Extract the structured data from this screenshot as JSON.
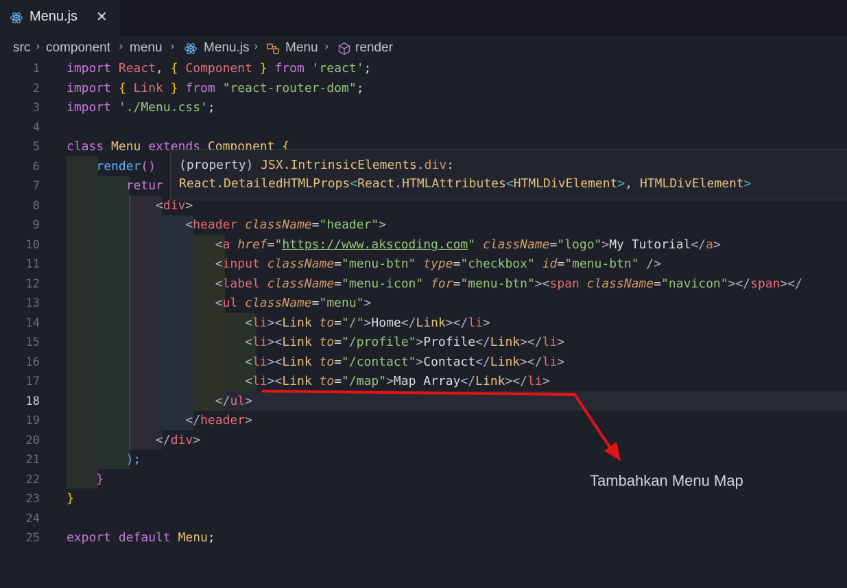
{
  "tab": {
    "label": "Menu.js",
    "close_glyph": "✕",
    "icon": "react-icon"
  },
  "breadcrumb": {
    "items": [
      "src",
      "component",
      "menu",
      "Menu.js",
      "Menu",
      "render"
    ],
    "separator": "›"
  },
  "hover": {
    "line1": "(property) JSX.IntrinsicElements.div:",
    "line2": "React.DetailedHTMLProps<React.HTMLAttributes<HTMLDivElement>, HTMLDivElement>"
  },
  "annotation": {
    "text": "Tambahkan Menu Map",
    "color": "#e31414"
  },
  "active_line": 18,
  "lines": [
    {
      "n": "1",
      "tokens": [
        [
          "import ",
          "k"
        ],
        [
          "React",
          "t"
        ],
        [
          ", ",
          ""
        ],
        [
          "{ ",
          "br"
        ],
        [
          "Component",
          "t"
        ],
        [
          " }",
          "br"
        ],
        [
          " from ",
          "k"
        ],
        [
          "'react'",
          "s"
        ],
        [
          ";",
          ""
        ]
      ]
    },
    {
      "n": "2",
      "tokens": [
        [
          "import ",
          "k"
        ],
        [
          "{ ",
          "br"
        ],
        [
          "Link",
          "t"
        ],
        [
          " }",
          "br"
        ],
        [
          " from ",
          "k"
        ],
        [
          "\"react-router-dom\"",
          "s"
        ],
        [
          ";",
          ""
        ]
      ]
    },
    {
      "n": "3",
      "tokens": [
        [
          "import ",
          "k"
        ],
        [
          "'./Menu.css'",
          "s"
        ],
        [
          ";",
          ""
        ]
      ]
    },
    {
      "n": "4",
      "tokens": []
    },
    {
      "n": "5",
      "tokens": [
        [
          "class ",
          "k"
        ],
        [
          "Menu ",
          "c"
        ],
        [
          "extends ",
          "k"
        ],
        [
          "Component ",
          "c"
        ],
        [
          "{",
          "br"
        ]
      ]
    },
    {
      "n": "6",
      "tokens": [
        [
          "    ",
          ""
        ],
        [
          "render",
          "f"
        ],
        [
          "()",
          "brp"
        ]
      ]
    },
    {
      "n": "7",
      "tokens": [
        [
          "        ",
          ""
        ],
        [
          "retur",
          "k"
        ]
      ]
    },
    {
      "n": "8",
      "tokens": [
        [
          "            ",
          ""
        ],
        [
          "<",
          "p"
        ],
        [
          "div",
          "t"
        ],
        [
          ">",
          "p"
        ]
      ]
    },
    {
      "n": "9",
      "tokens": [
        [
          "                ",
          ""
        ],
        [
          "<",
          "p"
        ],
        [
          "header ",
          "t"
        ],
        [
          "className",
          "a"
        ],
        [
          "=",
          ""
        ],
        [
          "\"header\"",
          "s"
        ],
        [
          ">",
          "p"
        ]
      ]
    },
    {
      "n": "10",
      "tokens": [
        [
          "                    ",
          ""
        ],
        [
          "<",
          "p"
        ],
        [
          "a ",
          "t"
        ],
        [
          "href",
          "a"
        ],
        [
          "=",
          ""
        ],
        [
          "\"",
          "s"
        ],
        [
          "https://www.akscoding.com",
          "u"
        ],
        [
          "\" ",
          "s"
        ],
        [
          "className",
          "a"
        ],
        [
          "=",
          ""
        ],
        [
          "\"logo\"",
          "s"
        ],
        [
          ">",
          "p"
        ],
        [
          "My Tutorial",
          ""
        ],
        [
          "</",
          "p"
        ],
        [
          "a",
          "t"
        ],
        [
          ">",
          "p"
        ]
      ]
    },
    {
      "n": "11",
      "tokens": [
        [
          "                    ",
          ""
        ],
        [
          "<",
          "p"
        ],
        [
          "input ",
          "t"
        ],
        [
          "className",
          "a"
        ],
        [
          "=",
          ""
        ],
        [
          "\"menu-btn\" ",
          "s"
        ],
        [
          "type",
          "a"
        ],
        [
          "=",
          ""
        ],
        [
          "\"checkbox\" ",
          "s"
        ],
        [
          "id",
          "a"
        ],
        [
          "=",
          ""
        ],
        [
          "\"menu-btn\" ",
          "s"
        ],
        [
          "/>",
          "p"
        ]
      ]
    },
    {
      "n": "12",
      "tokens": [
        [
          "                    ",
          ""
        ],
        [
          "<",
          "p"
        ],
        [
          "label ",
          "t"
        ],
        [
          "className",
          "a"
        ],
        [
          "=",
          ""
        ],
        [
          "\"menu-icon\" ",
          "s"
        ],
        [
          "for",
          "a"
        ],
        [
          "=",
          ""
        ],
        [
          "\"menu-btn\"",
          "s"
        ],
        [
          ">",
          "p"
        ],
        [
          "<",
          "p"
        ],
        [
          "span ",
          "t"
        ],
        [
          "className",
          "a"
        ],
        [
          "=",
          ""
        ],
        [
          "\"navicon\"",
          "s"
        ],
        [
          "></",
          "p"
        ],
        [
          "span",
          "t"
        ],
        [
          "></",
          "p"
        ]
      ]
    },
    {
      "n": "13",
      "tokens": [
        [
          "                    ",
          ""
        ],
        [
          "<",
          "p"
        ],
        [
          "ul ",
          "t"
        ],
        [
          "className",
          "a"
        ],
        [
          "=",
          ""
        ],
        [
          "\"menu\"",
          "s"
        ],
        [
          ">",
          "p"
        ]
      ]
    },
    {
      "n": "14",
      "tokens": [
        [
          "                        ",
          ""
        ],
        [
          "<",
          "p"
        ],
        [
          "li",
          "t"
        ],
        [
          "><",
          "p"
        ],
        [
          "Link ",
          "c"
        ],
        [
          "to",
          "a"
        ],
        [
          "=",
          ""
        ],
        [
          "\"/\"",
          "s"
        ],
        [
          ">",
          "p"
        ],
        [
          "Home",
          ""
        ],
        [
          "</",
          "p"
        ],
        [
          "Link",
          "c"
        ],
        [
          "></",
          "p"
        ],
        [
          "li",
          "t"
        ],
        [
          ">",
          "p"
        ]
      ]
    },
    {
      "n": "15",
      "tokens": [
        [
          "                        ",
          ""
        ],
        [
          "<",
          "p"
        ],
        [
          "li",
          "t"
        ],
        [
          "><",
          "p"
        ],
        [
          "Link ",
          "c"
        ],
        [
          "to",
          "a"
        ],
        [
          "=",
          ""
        ],
        [
          "\"/profile\"",
          "s"
        ],
        [
          ">",
          "p"
        ],
        [
          "Profile",
          ""
        ],
        [
          "</",
          "p"
        ],
        [
          "Link",
          "c"
        ],
        [
          "></",
          "p"
        ],
        [
          "li",
          "t"
        ],
        [
          ">",
          "p"
        ]
      ]
    },
    {
      "n": "16",
      "tokens": [
        [
          "                        ",
          ""
        ],
        [
          "<",
          "p"
        ],
        [
          "li",
          "t"
        ],
        [
          "><",
          "p"
        ],
        [
          "Link ",
          "c"
        ],
        [
          "to",
          "a"
        ],
        [
          "=",
          ""
        ],
        [
          "\"/contact\"",
          "s"
        ],
        [
          ">",
          "p"
        ],
        [
          "Contact",
          ""
        ],
        [
          "</",
          "p"
        ],
        [
          "Link",
          "c"
        ],
        [
          "></",
          "p"
        ],
        [
          "li",
          "t"
        ],
        [
          ">",
          "p"
        ]
      ]
    },
    {
      "n": "17",
      "tokens": [
        [
          "                        ",
          ""
        ],
        [
          "<",
          "p"
        ],
        [
          "li",
          "t"
        ],
        [
          "><",
          "p"
        ],
        [
          "Link ",
          "c"
        ],
        [
          "to",
          "a"
        ],
        [
          "=",
          ""
        ],
        [
          "\"/map\"",
          "s"
        ],
        [
          ">",
          "p"
        ],
        [
          "Map Array",
          ""
        ],
        [
          "</",
          "p"
        ],
        [
          "Link",
          "c"
        ],
        [
          "></",
          "p"
        ],
        [
          "li",
          "t"
        ],
        [
          ">",
          "p"
        ]
      ]
    },
    {
      "n": "18",
      "tokens": [
        [
          "                    ",
          ""
        ],
        [
          "</",
          "p"
        ],
        [
          "ul",
          "t"
        ],
        [
          ">",
          "p"
        ]
      ]
    },
    {
      "n": "19",
      "tokens": [
        [
          "                ",
          ""
        ],
        [
          "</",
          "p"
        ],
        [
          "header",
          "t"
        ],
        [
          ">",
          "p"
        ]
      ]
    },
    {
      "n": "20",
      "tokens": [
        [
          "            ",
          ""
        ],
        [
          "</",
          "p"
        ],
        [
          "div",
          "t"
        ],
        [
          ">",
          "p"
        ]
      ]
    },
    {
      "n": "21",
      "tokens": [
        [
          "        ",
          ""
        ],
        [
          ");",
          "f"
        ]
      ]
    },
    {
      "n": "22",
      "tokens": [
        [
          "    ",
          ""
        ],
        [
          "}",
          "brp"
        ]
      ]
    },
    {
      "n": "23",
      "tokens": [
        [
          "}",
          "br"
        ]
      ]
    },
    {
      "n": "24",
      "tokens": []
    },
    {
      "n": "25",
      "tokens": [
        [
          "export ",
          "k"
        ],
        [
          "default ",
          "k"
        ],
        [
          "Menu",
          "c"
        ],
        [
          ";",
          ""
        ]
      ]
    }
  ]
}
